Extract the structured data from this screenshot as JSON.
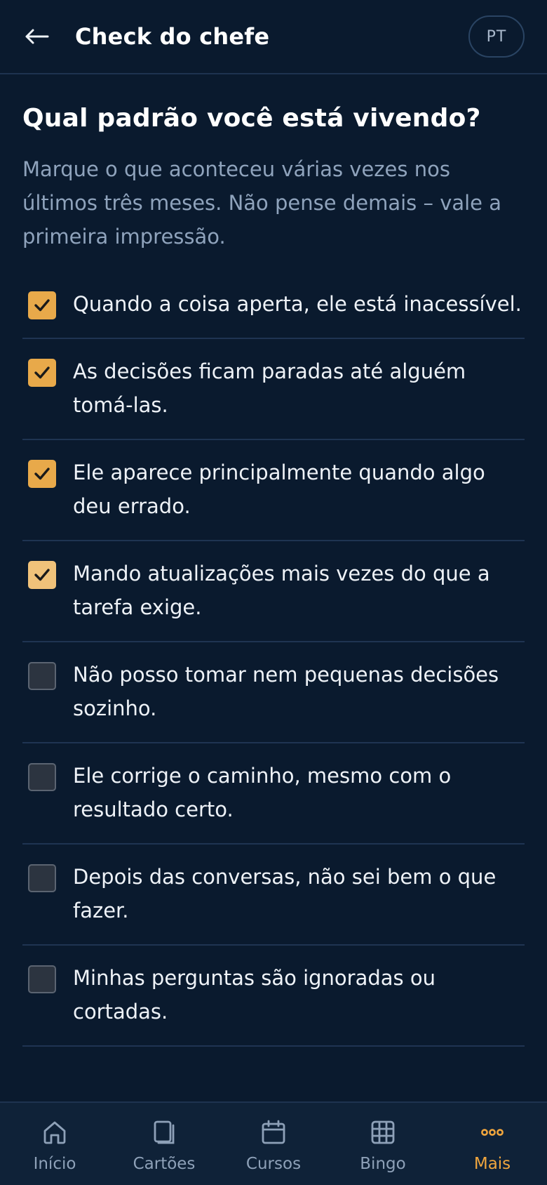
{
  "header": {
    "title": "Check do chefe",
    "lang": "PT",
    "back_icon": "arrow-left-icon"
  },
  "page": {
    "heading": "Qual padrão você está vivendo?",
    "description": "Marque o que aconteceu várias vezes nos últimos três meses. Não pense demais – vale a primeira impressão."
  },
  "items": [
    {
      "label": "Quando a coisa aperta, ele está inacessível.",
      "checked": true
    },
    {
      "label": "As decisões ficam paradas até alguém tomá-las.",
      "checked": true
    },
    {
      "label": "Ele aparece principalmente quando algo deu errado.",
      "checked": true
    },
    {
      "label": "Mando atualizações mais vezes do que a tarefa exige.",
      "checked": true
    },
    {
      "label": "Não posso tomar nem pequenas decisões sozinho.",
      "checked": false
    },
    {
      "label": "Ele corrige o caminho, mesmo com o resultado certo.",
      "checked": false
    },
    {
      "label": "Depois das conversas, não sei bem o que fazer.",
      "checked": false
    },
    {
      "label": "Minhas perguntas são ignoradas ou cortadas.",
      "checked": false
    }
  ],
  "nav": [
    {
      "label": "Início",
      "icon": "home-icon",
      "active": false
    },
    {
      "label": "Cartões",
      "icon": "cards-icon",
      "active": false
    },
    {
      "label": "Cursos",
      "icon": "calendar-icon",
      "active": false
    },
    {
      "label": "Bingo",
      "icon": "grid-icon",
      "active": false
    },
    {
      "label": "Mais",
      "icon": "more-dots-icon",
      "active": true
    }
  ],
  "colors": {
    "background": "#0a1a2e",
    "accent": "#e8a94a",
    "nav_active": "#f0a63e",
    "muted_text": "#8fa3bc"
  }
}
